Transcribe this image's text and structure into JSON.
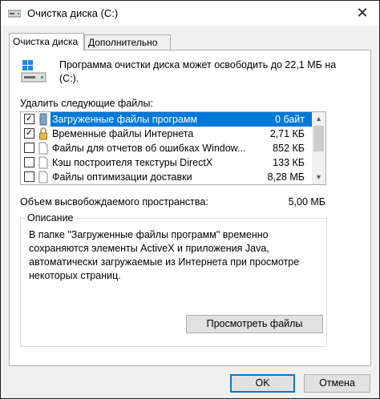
{
  "window": {
    "title": "Очистка диска  (C:)",
    "close_glyph": "✕"
  },
  "tabs": [
    {
      "label": "Очистка диска"
    },
    {
      "label": "Дополнительно"
    }
  ],
  "summary": "Программа очистки диска может освободить до 22,1 МБ на (C:).",
  "list": {
    "label": "Удалить следующие файлы:",
    "items": [
      {
        "name": "Загруженные файлы программ",
        "size": "0 байт",
        "checked": true,
        "selected": true,
        "icon": "folder-icon"
      },
      {
        "name": "Временные файлы Интернета",
        "size": "2,71 КБ",
        "checked": true,
        "selected": false,
        "icon": "lock-icon"
      },
      {
        "name": "Файлы для отчетов об ошибках Window...",
        "size": "852 КБ",
        "checked": false,
        "selected": false,
        "icon": "file-icon"
      },
      {
        "name": "Кэш построителя текстуры DirectX",
        "size": "133 КБ",
        "checked": false,
        "selected": false,
        "icon": "file-icon"
      },
      {
        "name": "Файлы оптимизации доставки",
        "size": "8,28 МБ",
        "checked": false,
        "selected": false,
        "icon": "file-icon"
      }
    ]
  },
  "space": {
    "label": "Объем высвобождаемого пространства:",
    "value": "5,00 МБ"
  },
  "description": {
    "title": "Описание",
    "text": "В папке \"Загруженные файлы программ\" временно сохраняются элементы ActiveX и приложения Java, автоматически загружаемые из Интернета при просмотре некоторых страниц.",
    "view_button": "Просмотреть файлы"
  },
  "buttons": {
    "ok": "OK",
    "cancel": "Отмена"
  },
  "colors": {
    "selection": "#0078d7",
    "accent": "#0078d7"
  }
}
